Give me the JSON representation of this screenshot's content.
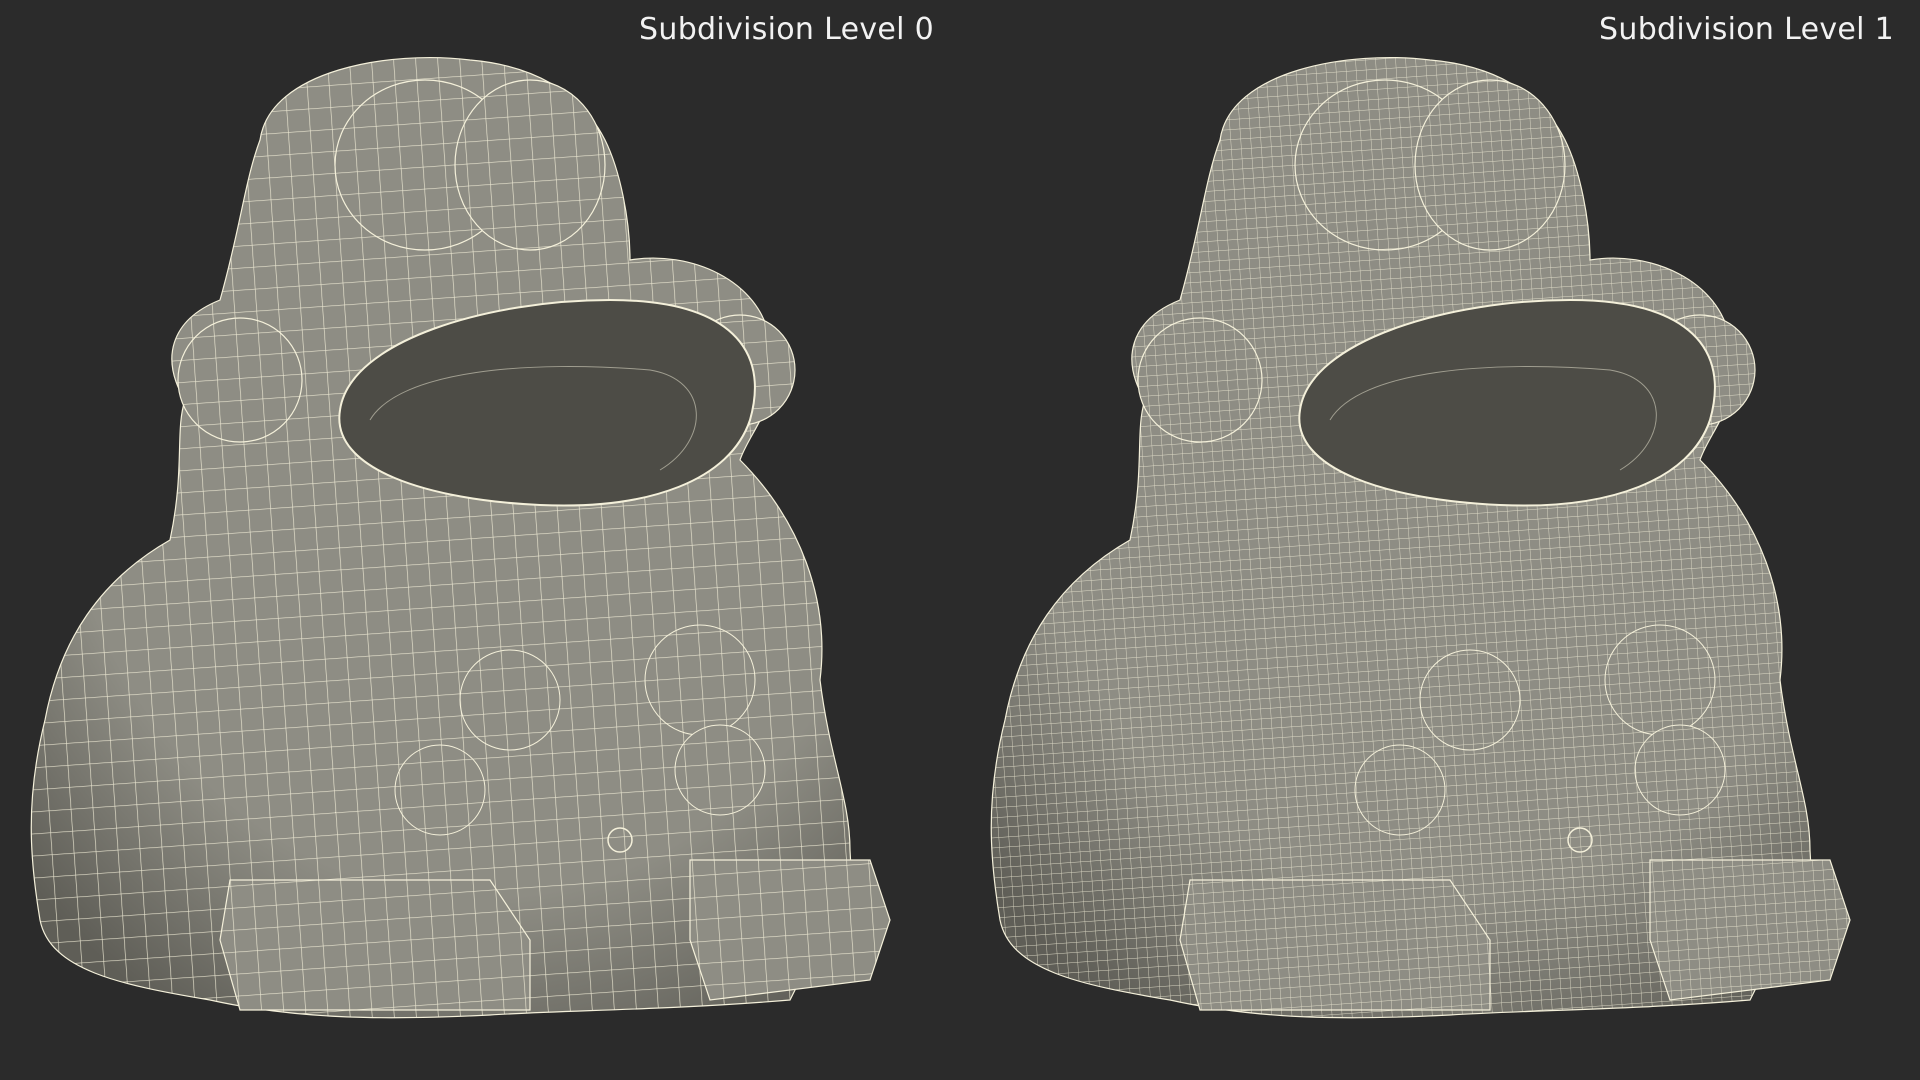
{
  "panels": [
    {
      "label": "Subdivision Level 0",
      "grid_spacing": 22
    },
    {
      "label": "Subdivision Level 1",
      "grid_spacing": 10
    }
  ],
  "colors": {
    "background": "#2b2b2b",
    "surface": "#8e8d84",
    "surface_shadow": "#5f5e57",
    "interior": "#4d4c46",
    "wire": "#f4f0da",
    "label": "#f2f2f2"
  }
}
